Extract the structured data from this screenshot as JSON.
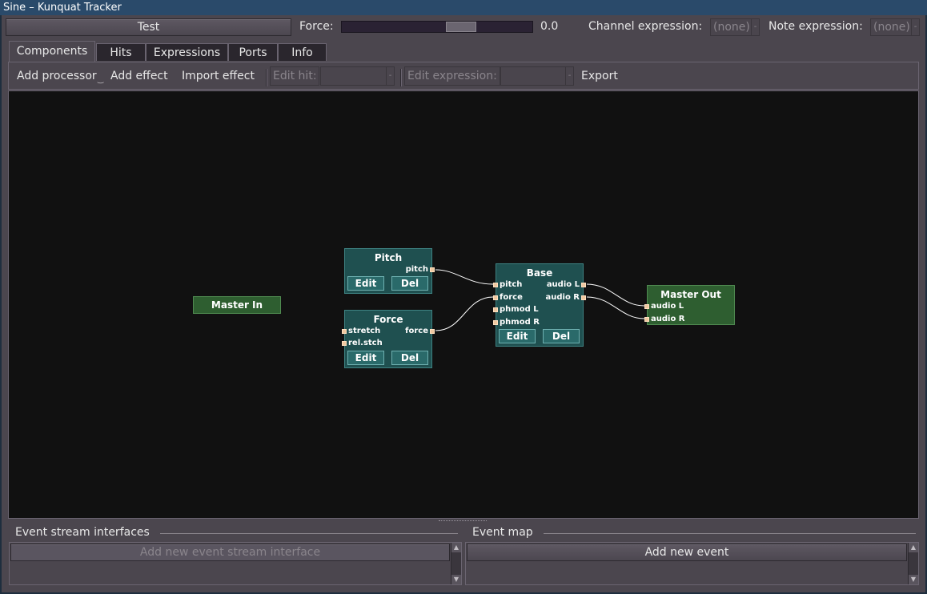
{
  "window": {
    "title": "Sine – Kunquat Tracker"
  },
  "top": {
    "test_button": "Test",
    "force_label": "Force:",
    "force_value": "0.0",
    "force_level": 0.65,
    "channel_expr_label": "Channel expression:",
    "channel_expr_value": "(none)",
    "note_expr_label": "Note expression:",
    "note_expr_value": "(none)"
  },
  "tabs": [
    {
      "label": "Components",
      "active": true
    },
    {
      "label": "Hits"
    },
    {
      "label": "Expressions"
    },
    {
      "label": "Ports"
    },
    {
      "label": "Info"
    }
  ],
  "toolbar": {
    "add_processor": "Add processor",
    "add_effect": "Add effect",
    "import_effect": "Import effect",
    "edit_hit": "Edit hit:",
    "edit_expression": "Edit expression:",
    "export": "Export"
  },
  "graph": {
    "master_in": {
      "title": "Master In"
    },
    "pitch": {
      "title": "Pitch",
      "out_port": "pitch",
      "edit": "Edit",
      "del": "Del"
    },
    "force": {
      "title": "Force",
      "in_ports": [
        "stretch",
        "rel.stch"
      ],
      "out_port": "force",
      "edit": "Edit",
      "del": "Del"
    },
    "base": {
      "title": "Base",
      "in_ports": [
        "pitch",
        "force",
        "phmod L",
        "phmod R"
      ],
      "out_ports": [
        "audio L",
        "audio R"
      ],
      "edit": "Edit",
      "del": "Del"
    },
    "master_out": {
      "title": "Master Out",
      "in_ports": [
        "audio L",
        "audio R"
      ]
    }
  },
  "bottom": {
    "esi_label": "Event stream interfaces",
    "esi_button": "Add new event stream interface",
    "event_map_label": "Event map",
    "event_map_button": "Add new event"
  },
  "colors": {
    "processor_bg": "#1f5050",
    "master_bg": "#2e5e30",
    "port_dot": "#f0c8a0",
    "canvas_bg": "#111111"
  }
}
